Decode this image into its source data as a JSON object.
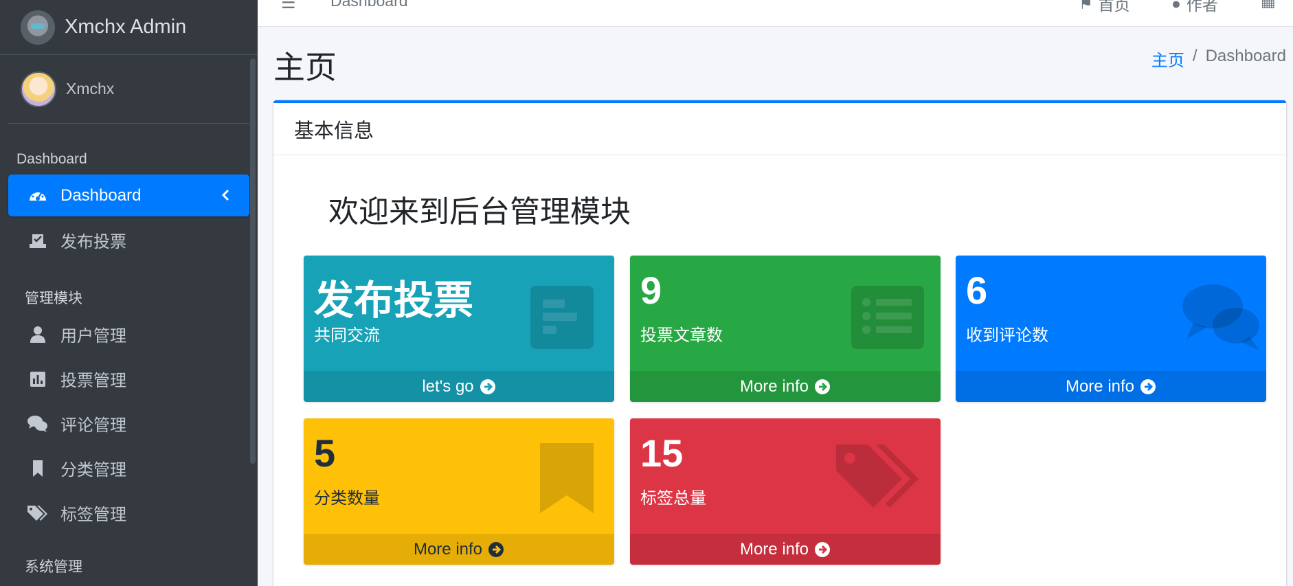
{
  "brand": {
    "name": "Xmchx Admin"
  },
  "user": {
    "name": "Xmchx"
  },
  "sidebar": {
    "header_1": "Dashboard",
    "header_2": "管理模块",
    "items": [
      {
        "label": "Dashboard",
        "icon": "tachometer-icon",
        "active": true
      },
      {
        "label": "发布投票",
        "icon": "vote-box-icon"
      },
      {
        "label": "用户管理",
        "icon": "user-icon"
      },
      {
        "label": "投票管理",
        "icon": "bar-chart-icon"
      },
      {
        "label": "评论管理",
        "icon": "comments-icon"
      },
      {
        "label": "分类管理",
        "icon": "bookmark-icon"
      },
      {
        "label": "标签管理",
        "icon": "tags-icon"
      }
    ],
    "cut_off_header": "系统管理"
  },
  "topbar": {
    "crumb": "Dashboard",
    "home_label": "首页",
    "author_label": "作者"
  },
  "content": {
    "title": "主页",
    "breadcrumb": {
      "home": "主页",
      "separator": "/",
      "current": "Dashboard"
    },
    "card_title": "基本信息",
    "welcome": "欢迎来到后台管理模块"
  },
  "boxes": [
    {
      "value": "发布投票",
      "desc": "共同交流",
      "link": "let's go",
      "color": "#17a2b8",
      "icon": "align-left-icon"
    },
    {
      "value": "9",
      "desc": "投票文章数",
      "link": "More info",
      "color": "#28a745",
      "icon": "list-icon"
    },
    {
      "value": "6",
      "desc": "收到评论数",
      "link": "More info",
      "color": "#007bff",
      "icon": "comments-icon"
    },
    {
      "value": "5",
      "desc": "分类数量",
      "link": "More info",
      "color": "#ffc107",
      "icon": "bookmark-icon"
    },
    {
      "value": "15",
      "desc": "标签总量",
      "link": "More info",
      "color": "#dc3545",
      "icon": "tags-icon"
    }
  ]
}
